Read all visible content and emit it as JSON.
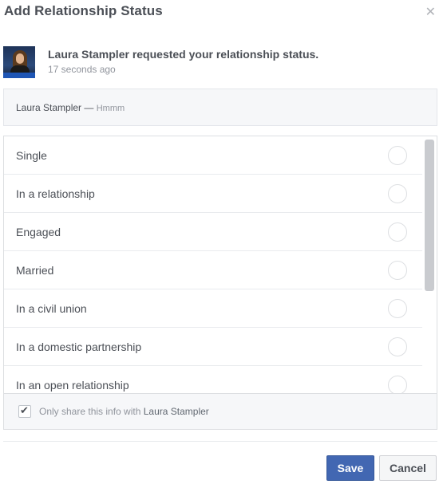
{
  "dialog": {
    "title": "Add Relationship Status",
    "close_icon": "close-icon"
  },
  "request": {
    "text": "Laura Stampler requested your relationship status.",
    "time": "17 seconds ago"
  },
  "name_box": {
    "name": "Laura Stampler —",
    "note": "Hmmm"
  },
  "options": [
    {
      "label": "Single",
      "selected": false
    },
    {
      "label": "In a relationship",
      "selected": false
    },
    {
      "label": "Engaged",
      "selected": false
    },
    {
      "label": "Married",
      "selected": false
    },
    {
      "label": "In a civil union",
      "selected": false
    },
    {
      "label": "In a domestic partnership",
      "selected": false
    },
    {
      "label": "In an open relationship",
      "selected": false
    }
  ],
  "share": {
    "checked": true,
    "text": "Only share this info with",
    "who": "Laura Stampler"
  },
  "buttons": {
    "save": "Save",
    "cancel": "Cancel"
  },
  "colors": {
    "primary": "#4267b2",
    "text": "#4b4f56",
    "muted": "#90949c"
  }
}
